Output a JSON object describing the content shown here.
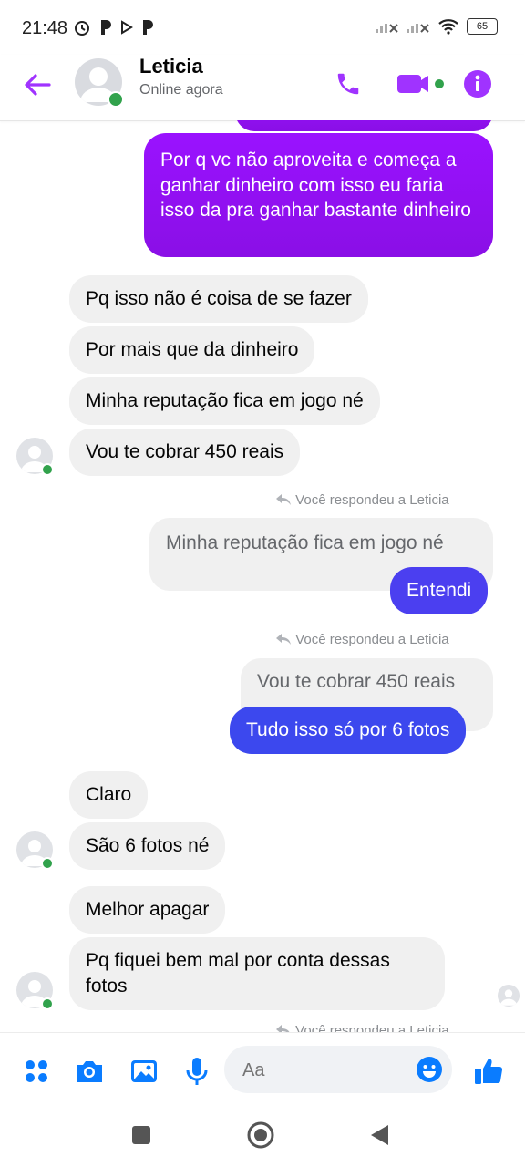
{
  "status_bar": {
    "time": "21:48",
    "battery": "65"
  },
  "header": {
    "name": "Leticia",
    "status": "Online agora"
  },
  "messages": {
    "m1": "Por q vc não aproveita e começa a ganhar dinheiro com isso eu faria isso da pra ganhar bastante dinheiro",
    "m2": "Pq isso não é coisa de se fazer",
    "m3": "Por mais que da dinheiro",
    "m4": "Minha reputação fica em jogo né",
    "m5": "Vou te cobrar 450 reais",
    "replied1": "Você respondeu a Leticia",
    "quote1": "Minha reputação fica em jogo né",
    "m6": "Entendi",
    "replied2": "Você respondeu a Leticia",
    "quote2": "Vou te cobrar 450 reais",
    "m7": "Tudo isso só por 6 fotos",
    "m8": "Claro",
    "m9": "São 6 fotos né",
    "m10": "Melhor apagar",
    "m11": "Pq fiquei bem mal por conta dessas fotos",
    "replied3": "Você respondeu a Leticia"
  },
  "composer": {
    "placeholder": "Aa"
  },
  "colors": {
    "accent": "#a033ff",
    "outgoing_purple": "#9a12ff",
    "outgoing_blue": "#3c48ee",
    "online": "#31a24c",
    "icon_blue": "#0a7cff"
  }
}
